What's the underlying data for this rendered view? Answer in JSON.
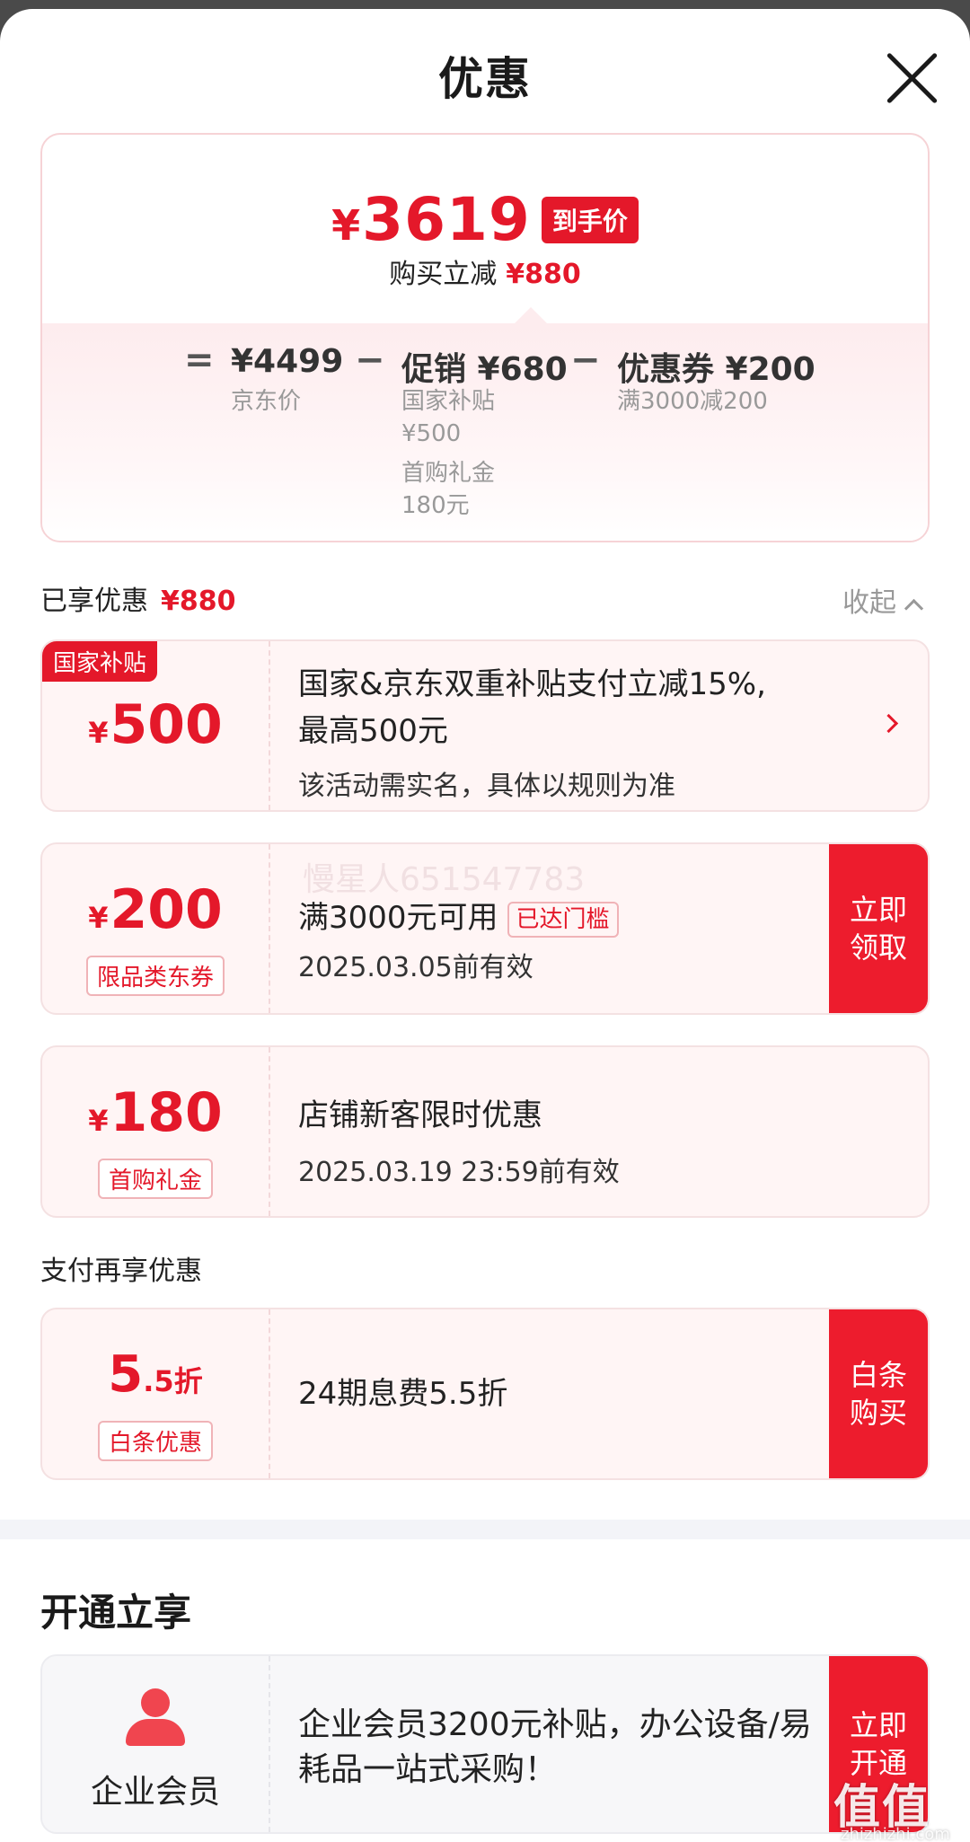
{
  "header": {
    "title": "优惠"
  },
  "summary": {
    "yen": "¥",
    "final_price": "3619",
    "final_tag": "到手价",
    "save_label": "购买立减",
    "save_amount": "¥880",
    "equals": "=",
    "minus": "−",
    "jd_price": "¥4499",
    "jd_label": "京东价",
    "promo_amount": "促销 ¥680",
    "promo_sub1": "国家补贴",
    "promo_sub1_val": "¥500",
    "promo_sub2": "首购礼金",
    "promo_sub2_val": "180元",
    "coupon_amount": "优惠券 ¥200",
    "coupon_sub": "满3000减200"
  },
  "enjoyed": {
    "label": "已享优惠",
    "amount": "¥880",
    "collapse": "收起"
  },
  "promos": [
    {
      "corner": "国家补贴",
      "yen": "¥",
      "amount": "500",
      "line1": "国家&京东双重补贴支付立减15%,",
      "line2": "最高500元",
      "line3": "该活动需实名，具体以规则为准"
    },
    {
      "yen": "¥",
      "amount": "200",
      "tag": "限品类东券",
      "line1": "满3000元可用",
      "reached": "已达门槛",
      "line2": "2025.03.05前有效",
      "action": "立即领取",
      "watermark": "慢星人651547783"
    },
    {
      "yen": "¥",
      "amount": "180",
      "tag": "首购礼金",
      "line1": "店铺新客限时优惠",
      "line2": "2025.03.19 23:59前有效"
    }
  ],
  "pay": {
    "label": "支付再享优惠",
    "big": "5",
    "small": ".5折",
    "tag": "白条优惠",
    "text": "24期息费5.5折",
    "action": "白条购买"
  },
  "open": {
    "title": "开通立享",
    "member_label": "企业会员",
    "text": "企业会员3200元补贴，办公设备/易耗品一站式采购！",
    "action": "立即开通"
  },
  "site": {
    "mark": "值值值",
    "url": "zhizhizhi.com"
  },
  "colors": {
    "accent": "#e4182a",
    "button": "#ed1c2d"
  }
}
